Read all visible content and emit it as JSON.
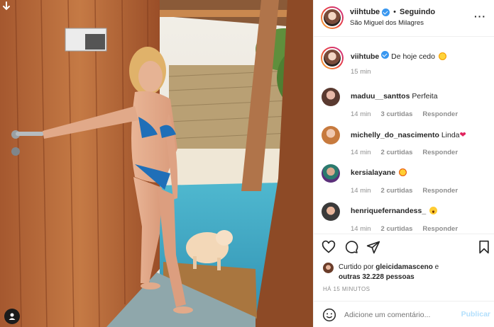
{
  "post": {
    "username": "viihtube",
    "follow_status": "Seguindo",
    "separator": "•",
    "location": "São Miguel dos Milagres",
    "caption": "De hoje cedo",
    "caption_emoji": "sun-with-face",
    "caption_time": "15 min"
  },
  "comments": [
    {
      "username": "maduu__santtos",
      "text": "Perfeita",
      "emoji": "",
      "time": "14 min",
      "likes": "3 curtidas",
      "reply": "Responder"
    },
    {
      "username": "michelly_do_nascimento",
      "text": "Linda",
      "emoji": "red-heart",
      "time": "14 min",
      "likes": "2 curtidas",
      "reply": "Responder"
    },
    {
      "username": "kersialayane",
      "text": "",
      "emoji": "star-struck",
      "time": "14 min",
      "likes": "2 curtidas",
      "reply": "Responder"
    },
    {
      "username": "henriquefernandess_",
      "text": "",
      "emoji": "face-open-mouth",
      "time": "14 min",
      "likes": "2 curtidas",
      "reply": "Responder"
    }
  ],
  "likes": {
    "prefix": "Curtido por",
    "first_user": "gleicidamasceno",
    "connector": "e",
    "others": "outras 32.228 pessoas"
  },
  "timestamp": "HÁ 15 MINUTOS",
  "comment_box": {
    "placeholder": "Adicione um comentário...",
    "publish_label": "Publicar"
  },
  "colors": {
    "verified": "#3897f0",
    "publish_disabled": "#b2dffc",
    "muted": "#8e8e8e",
    "border": "#efefef"
  }
}
